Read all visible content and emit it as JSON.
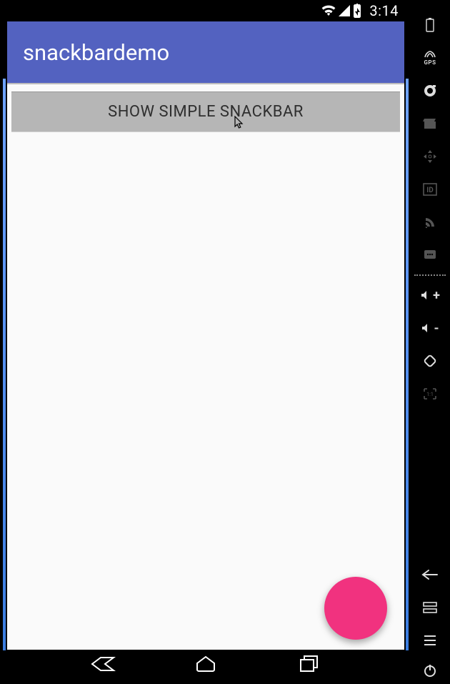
{
  "status": {
    "time": "3:14"
  },
  "app": {
    "title": "snackbardemo"
  },
  "buttons": {
    "show_snackbar": "SHOW SIMPLE SNACKBAR"
  },
  "colors": {
    "primary": "#5362c0",
    "accent": "#f1327f",
    "button_bg": "#b6b6b6"
  },
  "emulator_tools": {
    "battery": "battery",
    "gps": "GPS",
    "camera": "camera",
    "record": "record",
    "dpad": "dpad",
    "id": "ID",
    "rss": "rss",
    "sms": "sms",
    "vol_up": "volume-up",
    "vol_down": "volume-down",
    "rotate": "rotate",
    "scale": "1:1",
    "back": "back",
    "overview": "overview",
    "menu": "menu",
    "power": "power"
  }
}
